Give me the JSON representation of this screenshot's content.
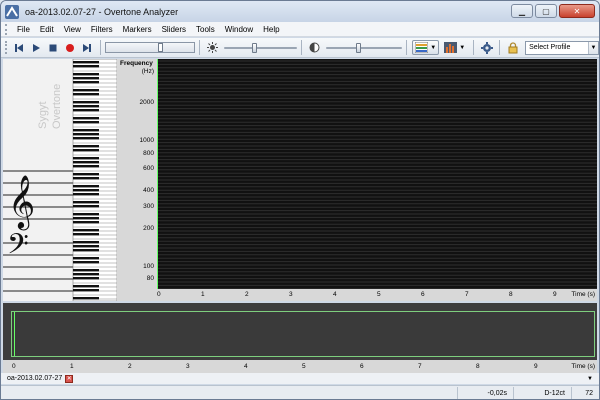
{
  "window": {
    "title": "oa-2013.02.07-27 - Overtone Analyzer"
  },
  "menu": [
    "File",
    "Edit",
    "View",
    "Filters",
    "Markers",
    "Sliders",
    "Tools",
    "Window",
    "Help"
  ],
  "toolbar": {
    "profile_select": "Select Profile"
  },
  "keyboard_panel": {
    "vertical_text_1": "Overtone",
    "vertical_text_2": "Sygyt"
  },
  "freq_axis": {
    "title_line1": "Frequency",
    "title_line2": "(Hz)",
    "ticks": [
      "2000",
      "1000",
      "800",
      "600",
      "400",
      "300",
      "200",
      "100",
      "80"
    ]
  },
  "time_axis": {
    "ticks": [
      "0",
      "1",
      "2",
      "3",
      "4",
      "5",
      "6",
      "7",
      "8",
      "9"
    ],
    "unit": "Time (s)"
  },
  "overview_axis": {
    "ticks": [
      "0",
      "1",
      "2",
      "3",
      "4",
      "5",
      "6",
      "7",
      "8",
      "9"
    ],
    "unit": "Time (s)"
  },
  "tab": {
    "label": "oa-2013.02.07-27"
  },
  "status": {
    "time": "-0,02s",
    "note": "D-12ct",
    "value": "72"
  },
  "colors": {
    "spectro_bg": "#111111",
    "cursor_green": "#66ff66",
    "titlebar": "#c7d4e6"
  }
}
